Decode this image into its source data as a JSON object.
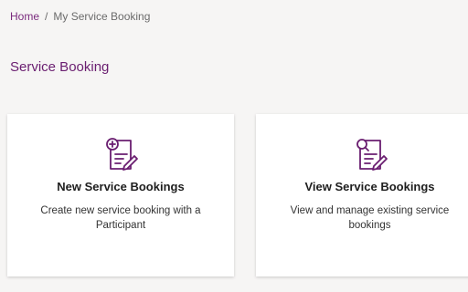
{
  "breadcrumb": {
    "home": "Home",
    "separator": "/",
    "current": "My Service Booking"
  },
  "page": {
    "title": "Service Booking"
  },
  "cards": [
    {
      "title": "New Service Bookings",
      "description": "Create new service booking with a Participant",
      "icon": "new-document-plus-icon"
    },
    {
      "title": "View Service Bookings",
      "description": "View and manage existing service bookings",
      "icon": "document-search-icon"
    }
  ],
  "colors": {
    "accent": "#6a1e70",
    "background": "#f6f5f4",
    "card": "#ffffff"
  }
}
